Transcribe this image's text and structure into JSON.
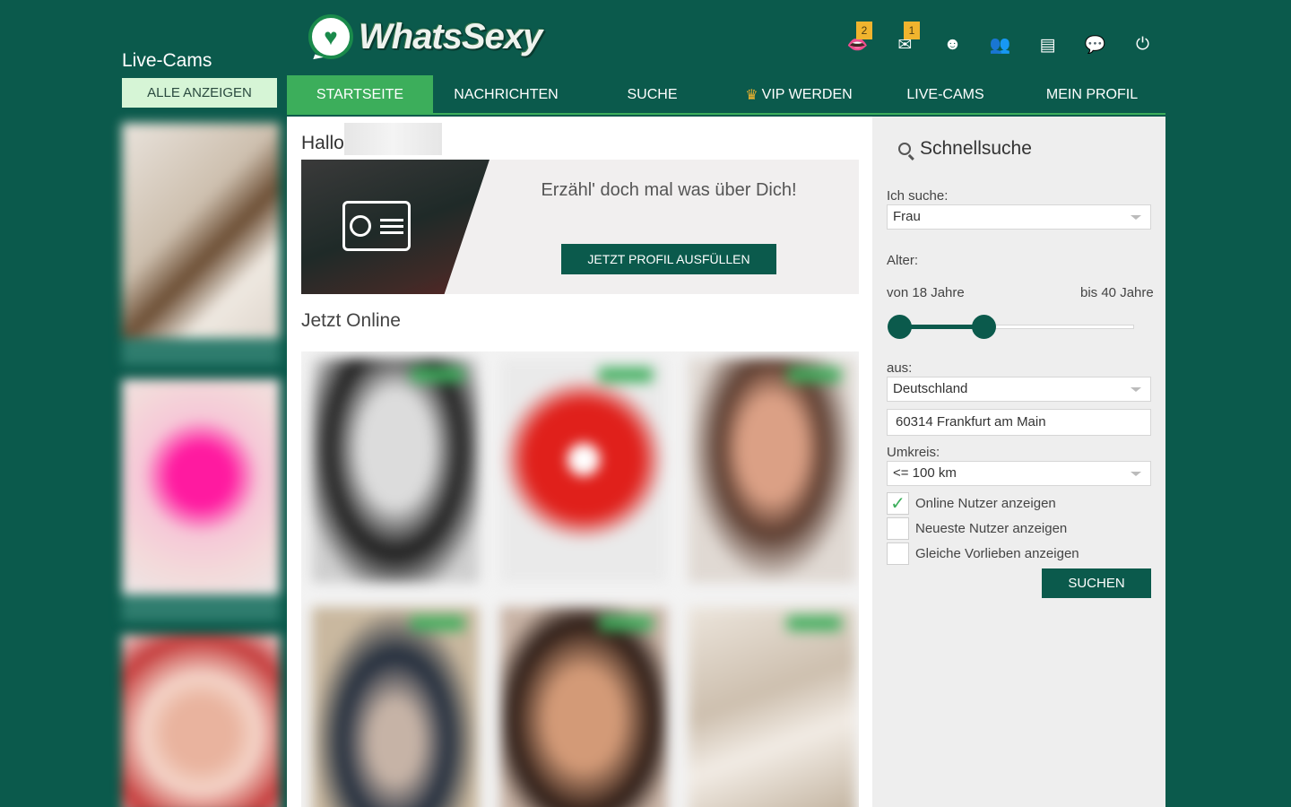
{
  "left": {
    "title": "Live-Cams",
    "all_button": "ALLE ANZEIGEN"
  },
  "header": {
    "logo_text": "WhatsSexy",
    "icons": [
      {
        "name": "kiss-icon",
        "glyph": "👄",
        "badge": "2"
      },
      {
        "name": "mail-icon",
        "glyph": "✉",
        "badge": "1"
      },
      {
        "name": "alien-icon",
        "glyph": "☻",
        "badge": null
      },
      {
        "name": "users-icon",
        "glyph": "👥",
        "badge": null
      },
      {
        "name": "cards-icon",
        "glyph": "▤",
        "badge": null
      },
      {
        "name": "chat-icon",
        "glyph": "💬",
        "badge": null
      },
      {
        "name": "power-icon",
        "glyph": "⏻",
        "badge": null
      }
    ]
  },
  "nav": {
    "items": [
      "STARTSEITE",
      "NACHRICHTEN",
      "SUCHE",
      "VIP WERDEN",
      "LIVE-CAMS",
      "MEIN PROFIL"
    ],
    "active_index": 0
  },
  "main": {
    "greeting": "Hallo",
    "promo": {
      "text": "Erzähl' doch mal was über Dich!",
      "button": "JETZT PROFIL AUSFÜLLEN"
    },
    "online_title": "Jetzt Online"
  },
  "sidebar": {
    "title": "Schnellsuche",
    "looking_label": "Ich suche:",
    "looking_value": "Frau",
    "age_label": "Alter:",
    "age_from": "von 18 Jahre",
    "age_to": "bis 40 Jahre",
    "from_label": "aus:",
    "country_value": "Deutschland",
    "city_value": "60314 Frankfurt am Main",
    "radius_label": "Umkreis:",
    "radius_value": "<= 100 km",
    "checkboxes": [
      {
        "label": "Online Nutzer anzeigen",
        "checked": true
      },
      {
        "label": "Neueste Nutzer anzeigen",
        "checked": false
      },
      {
        "label": "Gleiche Vorlieben anzeigen",
        "checked": false
      }
    ],
    "search_button": "SUCHEN"
  },
  "colors": {
    "brand_dark": "#0b5a4c",
    "brand_green": "#3cae5b",
    "badge": "#f0b42e"
  }
}
